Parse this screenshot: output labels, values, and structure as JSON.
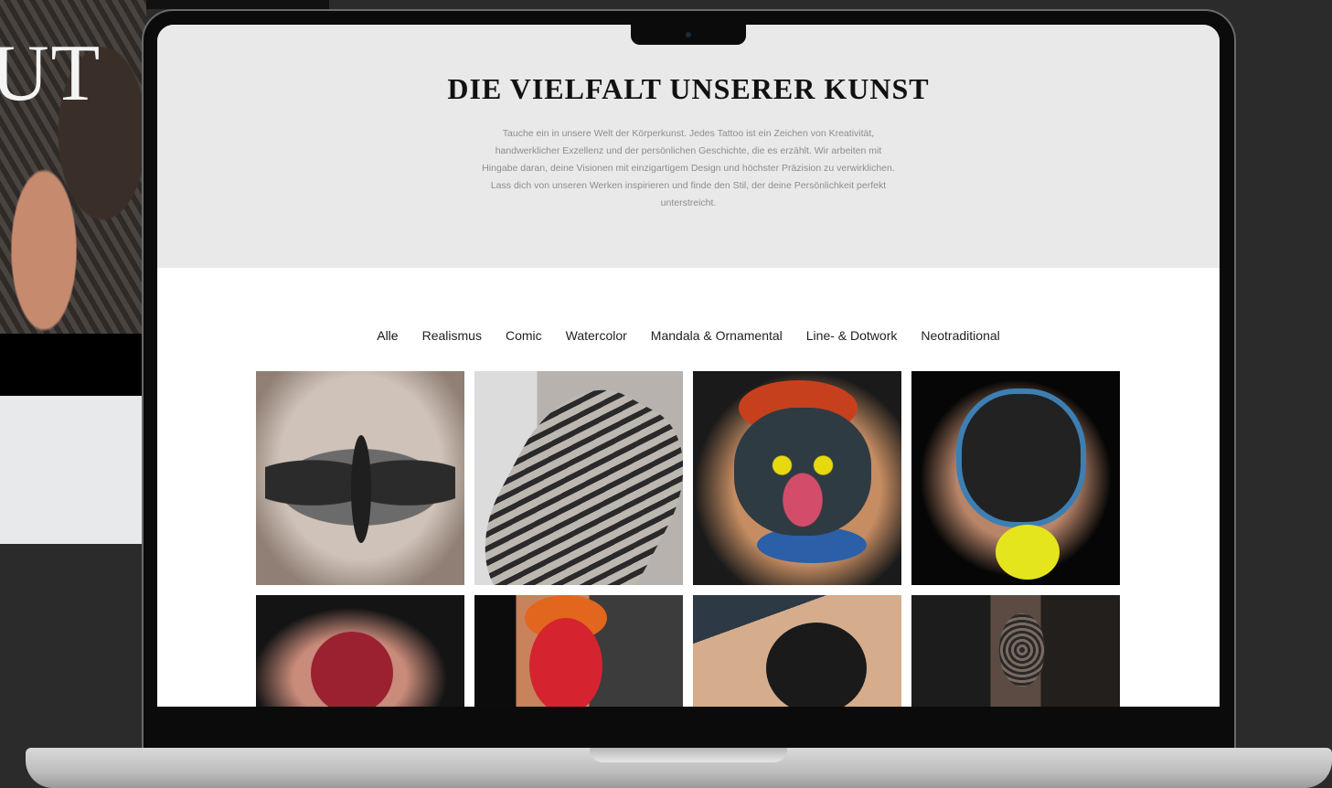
{
  "background_page": {
    "heading_fragment": "UT"
  },
  "screen": {
    "hero": {
      "title": "DIE VIELFALT UNSERER KUNST",
      "description": "Tauche ein in unsere Welt der Körperkunst. Jedes Tattoo ist ein Zeichen von Kreativität, handwerklicher Exzellenz und der persönlichen Geschichte, die es erzählt. Wir arbeiten mit Hingabe daran, deine Visionen mit einzigartigem Design und höchster Präzision zu verwirklichen. Lass dich von unseren Werken inspirieren und finde den Stil, der deine Persönlichkeit perfekt unterstreicht."
    },
    "filters": [
      {
        "label": "Alle"
      },
      {
        "label": "Realismus"
      },
      {
        "label": "Comic"
      },
      {
        "label": "Watercolor"
      },
      {
        "label": "Mandala & Ornamental"
      },
      {
        "label": "Line- & Dotwork"
      },
      {
        "label": "Neotraditional"
      }
    ],
    "gallery": [
      {
        "subject": "moth-back-tattoo"
      },
      {
        "subject": "skeleton-forearm-tattoo"
      },
      {
        "subject": "toothless-dragon-calf-tattoo"
      },
      {
        "subject": "dog-tennis-ball-calf-tattoo"
      },
      {
        "subject": "venom-calf-tattoo"
      },
      {
        "subject": "hibiscus-flower-tattoo"
      },
      {
        "subject": "rottweiler-portrait-tattoo"
      },
      {
        "subject": "mandala-dotwork-tattoo"
      }
    ]
  },
  "colors": {
    "page_background": "#2b2b2b",
    "hero_background": "#e9e9e9",
    "title_text": "#111111",
    "body_text": "#8d8d8d"
  }
}
